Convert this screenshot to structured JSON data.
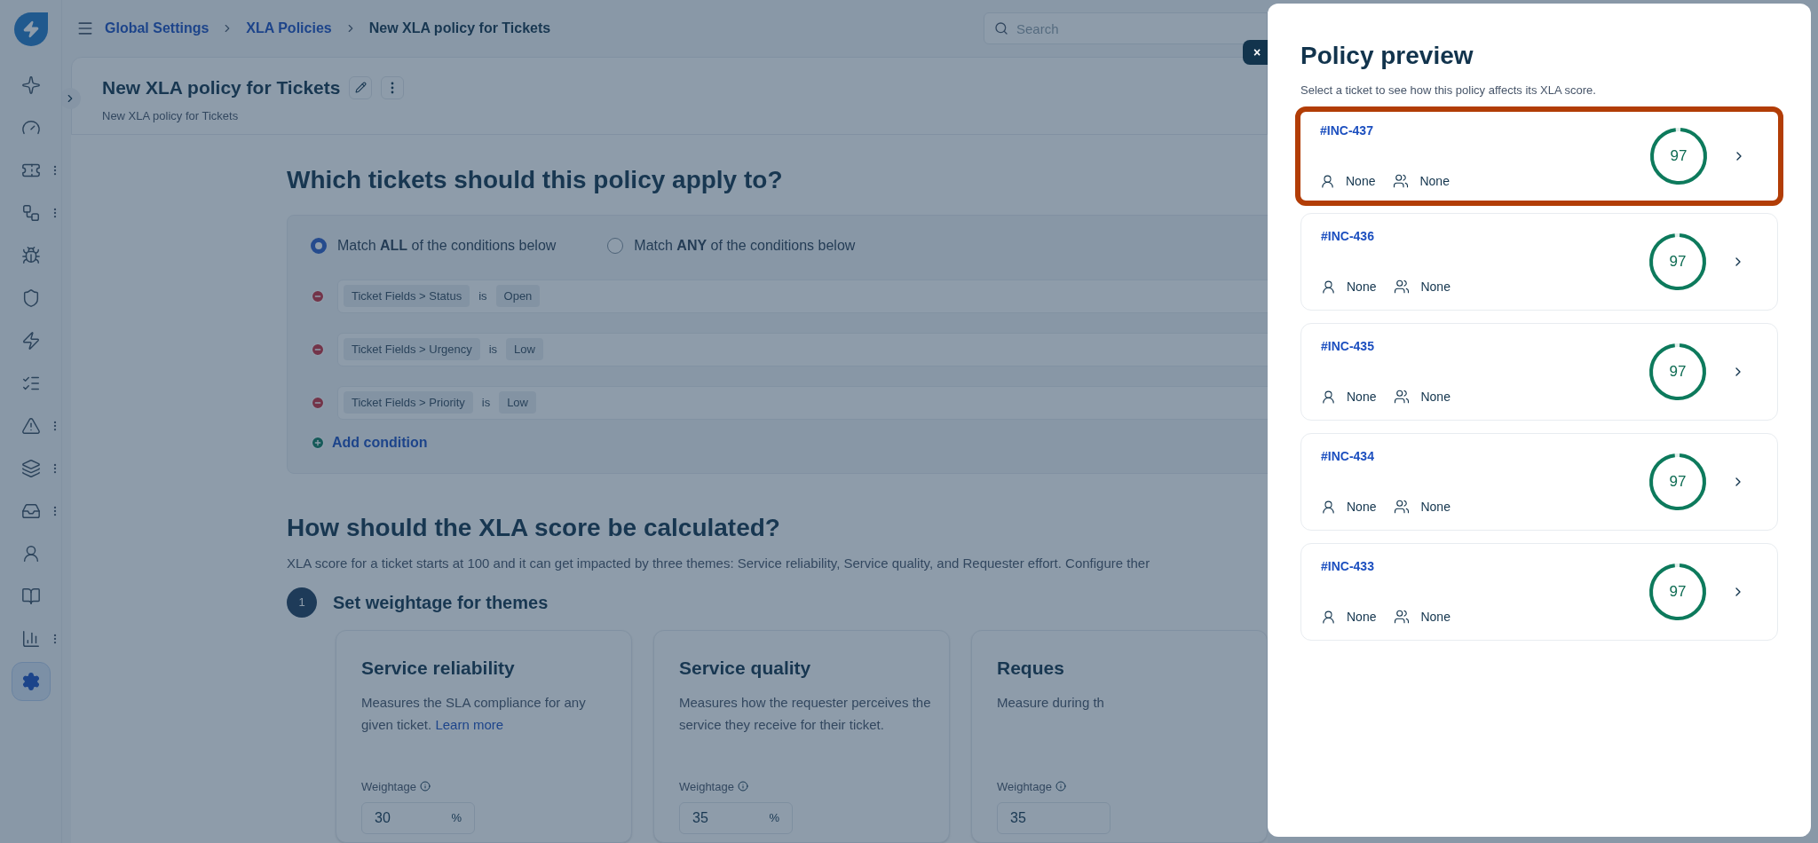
{
  "breadcrumbs": [
    {
      "label": "Global Settings",
      "kind": "link"
    },
    {
      "label": "XLA Policies",
      "kind": "link"
    },
    {
      "label": "New XLA policy for Tickets",
      "kind": "current"
    }
  ],
  "search": {
    "placeholder": "Search"
  },
  "sidebar": {
    "items": [
      {
        "has_menu": false,
        "selected": false
      },
      {
        "has_menu": false,
        "selected": false
      },
      {
        "has_menu": true,
        "selected": false
      },
      {
        "has_menu": true,
        "selected": false
      },
      {
        "has_menu": false,
        "selected": false
      },
      {
        "has_menu": false,
        "selected": false
      },
      {
        "has_menu": false,
        "selected": false
      },
      {
        "has_menu": false,
        "selected": false
      },
      {
        "has_menu": true,
        "selected": false
      },
      {
        "has_menu": true,
        "selected": false
      },
      {
        "has_menu": true,
        "selected": false
      },
      {
        "has_menu": false,
        "selected": false
      },
      {
        "has_menu": false,
        "selected": false
      },
      {
        "has_menu": true,
        "selected": false
      },
      {
        "has_menu": false,
        "selected": true
      }
    ]
  },
  "page": {
    "title": "New XLA policy for Tickets",
    "subtitle": "New XLA policy for Tickets"
  },
  "conditions_section": {
    "heading": "Which tickets should this policy apply to?",
    "match_options": [
      {
        "label": "Match **ALL** of the conditions below",
        "selected": true
      },
      {
        "label": "Match **ANY** of the conditions below",
        "selected": false
      }
    ],
    "conditions": [
      {
        "field": "Ticket Fields > Status",
        "operator": "is",
        "value": "Open"
      },
      {
        "field": "Ticket Fields > Urgency",
        "operator": "is",
        "value": "Low"
      },
      {
        "field": "Ticket Fields > Priority",
        "operator": "is",
        "value": "Low"
      }
    ],
    "add_label": "Add condition"
  },
  "score_section": {
    "heading": "How should the XLA score be calculated?",
    "description": "XLA score for a ticket starts at 100 and it can get impacted by three themes: Service reliability, Service quality, and Requester effort. Configure ther",
    "step_number": "1",
    "step_title": "Set weightage for themes",
    "themes": [
      {
        "title": "Service reliability",
        "description": "Measures the SLA compliance for any given ticket.",
        "link": "Learn more",
        "weight_label": "Weightage",
        "weight": "30",
        "unit": "%"
      },
      {
        "title": "Service quality",
        "description": "Measures how the requester perceives the service they receive for their ticket.",
        "weight_label": "Weightage",
        "weight": "35",
        "unit": "%"
      },
      {
        "title": "Reques",
        "description": "Measure during th",
        "weight_label": "Weightage",
        "weight": "35"
      }
    ]
  },
  "preview": {
    "close": "×",
    "title": "Policy preview",
    "subtitle": "Select a ticket to see how this policy affects its XLA score.",
    "tickets": [
      {
        "id": "#INC-437",
        "agent": "None",
        "group": "None",
        "score": "97",
        "level": 0.97,
        "highlighted": true
      },
      {
        "id": "#INC-436",
        "agent": "None",
        "group": "None",
        "score": "97",
        "level": 0.97,
        "highlighted": false
      },
      {
        "id": "#INC-435",
        "agent": "None",
        "group": "None",
        "score": "97",
        "level": 0.97,
        "highlighted": false
      },
      {
        "id": "#INC-434",
        "agent": "None",
        "group": "None",
        "score": "97",
        "level": 0.97,
        "highlighted": false
      },
      {
        "id": "#INC-433",
        "agent": "None",
        "group": "None",
        "score": "97",
        "level": 0.97,
        "highlighted": false
      }
    ]
  }
}
